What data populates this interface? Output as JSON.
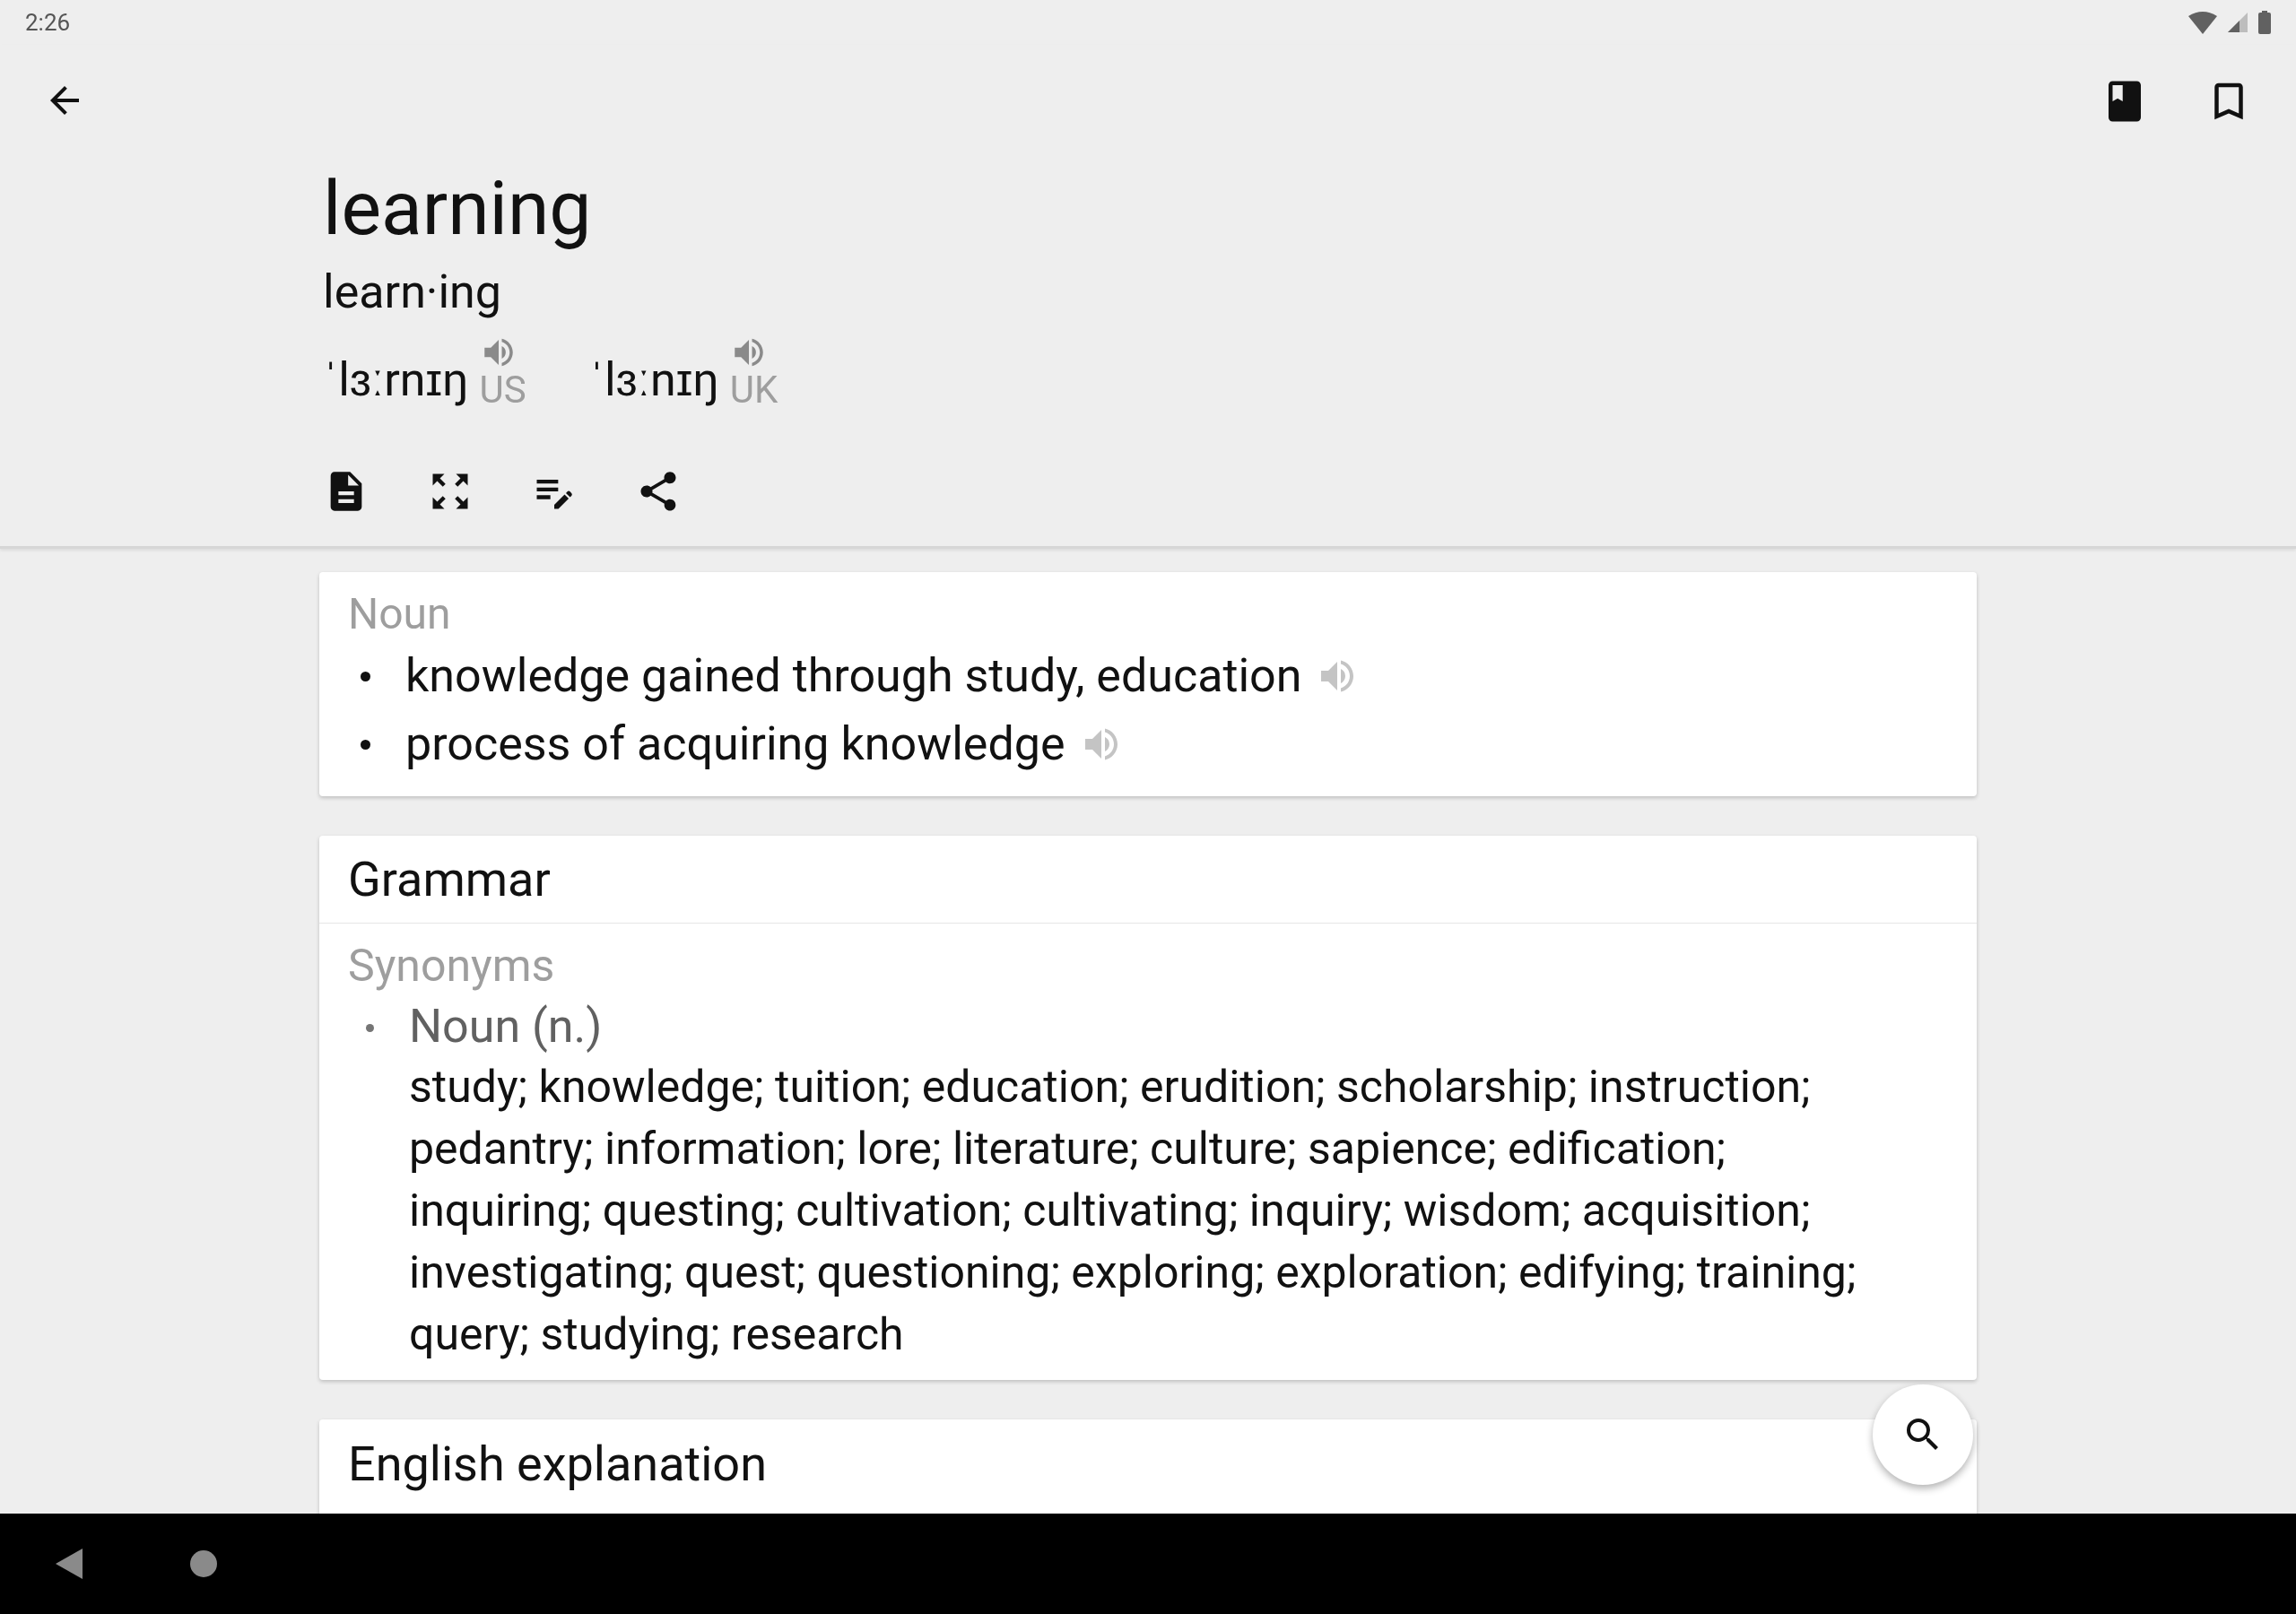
{
  "status_bar": {
    "time": "2:26"
  },
  "header": {
    "word": "learning",
    "syllables": "learn·ing",
    "pronunciations": [
      {
        "ipa": "ˈlɜːrnɪŋ",
        "region": "US"
      },
      {
        "ipa": "ˈlɜːnɪŋ",
        "region": "UK"
      }
    ]
  },
  "sections": [
    {
      "kind": "definitions",
      "part_of_speech": "Noun",
      "definitions": [
        "knowledge gained through study, education",
        "process of acquiring knowledge"
      ]
    },
    {
      "kind": "grammar",
      "title": "Grammar",
      "subheading": "Synonyms",
      "groups": [
        {
          "label": "Noun (n.)",
          "text": "study; knowledge; tuition; education; erudition; scholarship; instruction; pedantry; information; lore; literature; culture; sapience; edification; inquiring; questing; cultivation; cultivating; inquiry; wisdom; acquisition; investigating; quest; questioning; exploring; exploration; edifying; training; query; studying; research"
        }
      ]
    },
    {
      "kind": "heading",
      "title": "English explanation"
    }
  ]
}
